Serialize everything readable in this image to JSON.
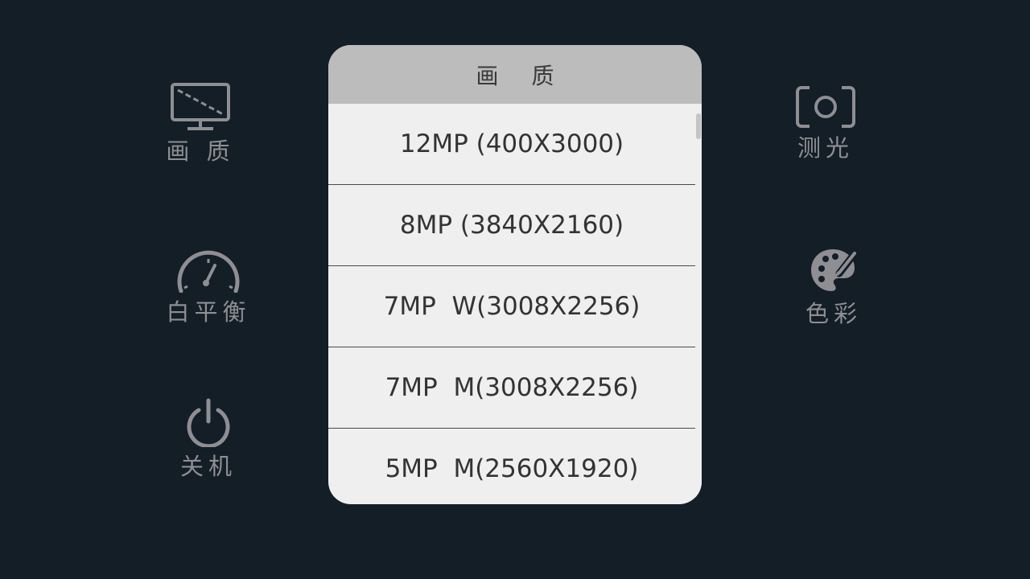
{
  "menu": {
    "quality": {
      "label": "画 质",
      "icon": "monitor-slash-icon"
    },
    "white_balance": {
      "label": "白平衡",
      "icon": "gauge-icon"
    },
    "power": {
      "label": "关机",
      "icon": "power-icon"
    },
    "metering": {
      "label": "测光",
      "icon": "camera-frame-icon"
    },
    "color": {
      "label": "色彩",
      "icon": "palette-icon"
    }
  },
  "dialog": {
    "title": "画 质",
    "options": [
      "12MP (400X3000)",
      "8MP (3840X2160)",
      "7MP  W(3008X2256)",
      "7MP  M(3008X2256)",
      "5MP  M(2560X1920)"
    ]
  },
  "colors": {
    "background": "#131e27",
    "icon": "#8e8e93",
    "dialog_body": "#efefef",
    "dialog_header": "#bcbcbc"
  }
}
